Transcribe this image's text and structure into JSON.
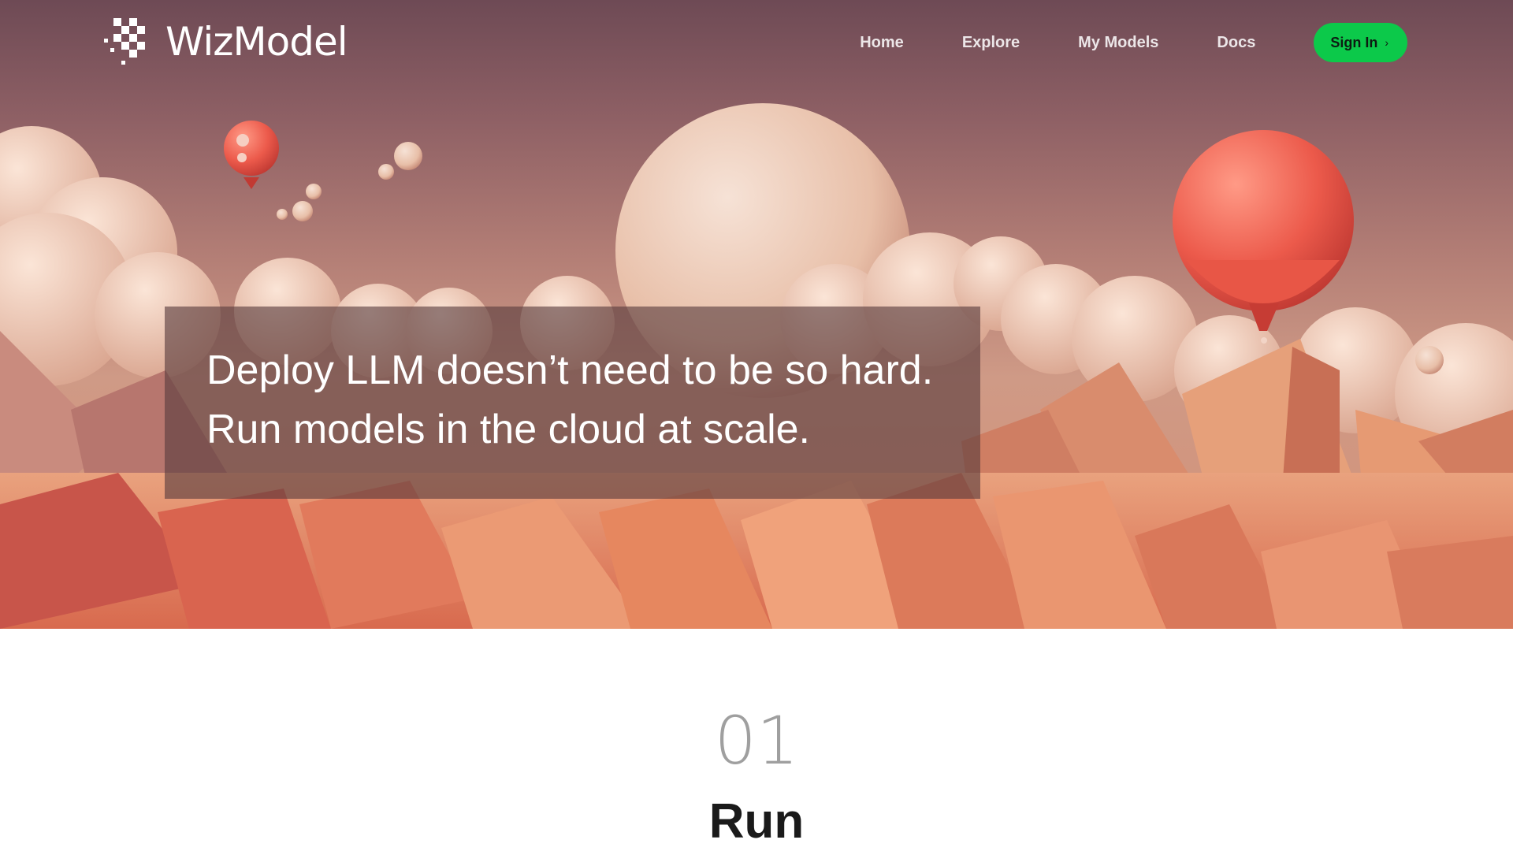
{
  "brand": {
    "name": "WizModel"
  },
  "nav": {
    "items": [
      {
        "label": "Home"
      },
      {
        "label": "Explore"
      },
      {
        "label": "My Models"
      },
      {
        "label": "Docs"
      }
    ],
    "signin_label": "Sign In",
    "signin_icon": "chevron-right-icon"
  },
  "hero": {
    "line1": "Deploy LLM doesn’t need to be so hard.",
    "line2": "Run models in the cloud at scale."
  },
  "section": {
    "number": "01",
    "title": "Run"
  },
  "colors": {
    "accent": "#0cc94a",
    "hero_sky": "#8d5f64",
    "headline_panel": "#583c3e"
  }
}
